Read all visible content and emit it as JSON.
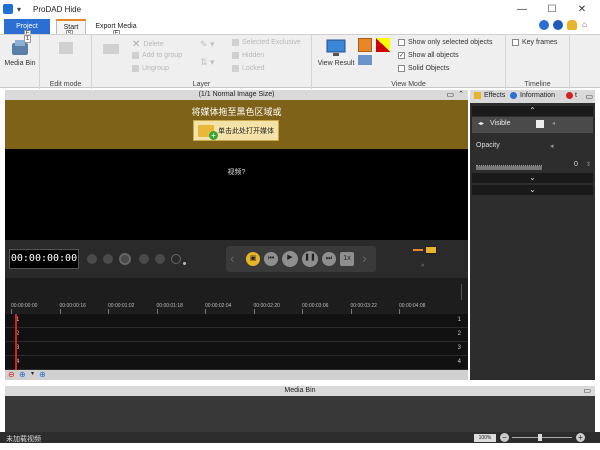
{
  "titlebar": {
    "app_title": "ProDAD Hide",
    "min": "—",
    "max": "☐",
    "close": "✕"
  },
  "tabs": {
    "project": "Project",
    "start": "Start",
    "export": "Export Media",
    "badges": [
      "F",
      "S",
      "E"
    ]
  },
  "ribbon": {
    "groups": {
      "edit_mode": "Edit mode",
      "layer": "Layer",
      "view_mode": "View Mode",
      "timeline": "Timeline"
    },
    "media_bin_label": "Media Bin",
    "media_bin_badge": "1",
    "view_result_label": "View Result",
    "layer_buttons": [
      "Delete",
      "Add to group",
      "Ungroup"
    ],
    "layer_right": [
      "Selected Exclusive",
      "Hidden",
      "Locked"
    ],
    "view_options": [
      {
        "label": "Show only selected objects",
        "checked": false
      },
      {
        "label": "Show all objects",
        "checked": true
      },
      {
        "label": "Solid Objects",
        "checked": false
      }
    ],
    "timeline_options": [
      {
        "label": "Key frames",
        "checked": false
      }
    ]
  },
  "preview": {
    "header": "(1/1  Normal Image Size)",
    "drop_text": "将媒体拖至黑色区域或",
    "open_label": "单击此处打开媒体",
    "video_q": "视频?"
  },
  "transport": {
    "timecode": "00:00:00:00"
  },
  "timeline": {
    "ticks": [
      "00:00:00:00",
      "00:00:00:16",
      "00:00:01:02",
      "00:00:01:18",
      "00:00:02:04",
      "00:00:02:20",
      "00:00:03:06",
      "00:00:03:22",
      "00:00:04:08"
    ],
    "tracks": [
      "1",
      "2",
      "3",
      "4"
    ]
  },
  "rpanel": {
    "tabs": [
      "Effects",
      "Information",
      "t"
    ],
    "visible_label": "Visible",
    "opacity_label": "Opacity",
    "opacity_value": "0"
  },
  "media_bin": {
    "header": "Media Bin"
  },
  "status": {
    "left": "未加载视频",
    "zoom": "100%"
  },
  "colors": {
    "accent": "#2a6fd1",
    "drop_band": "#7d6218",
    "playhead": "#d92020"
  }
}
